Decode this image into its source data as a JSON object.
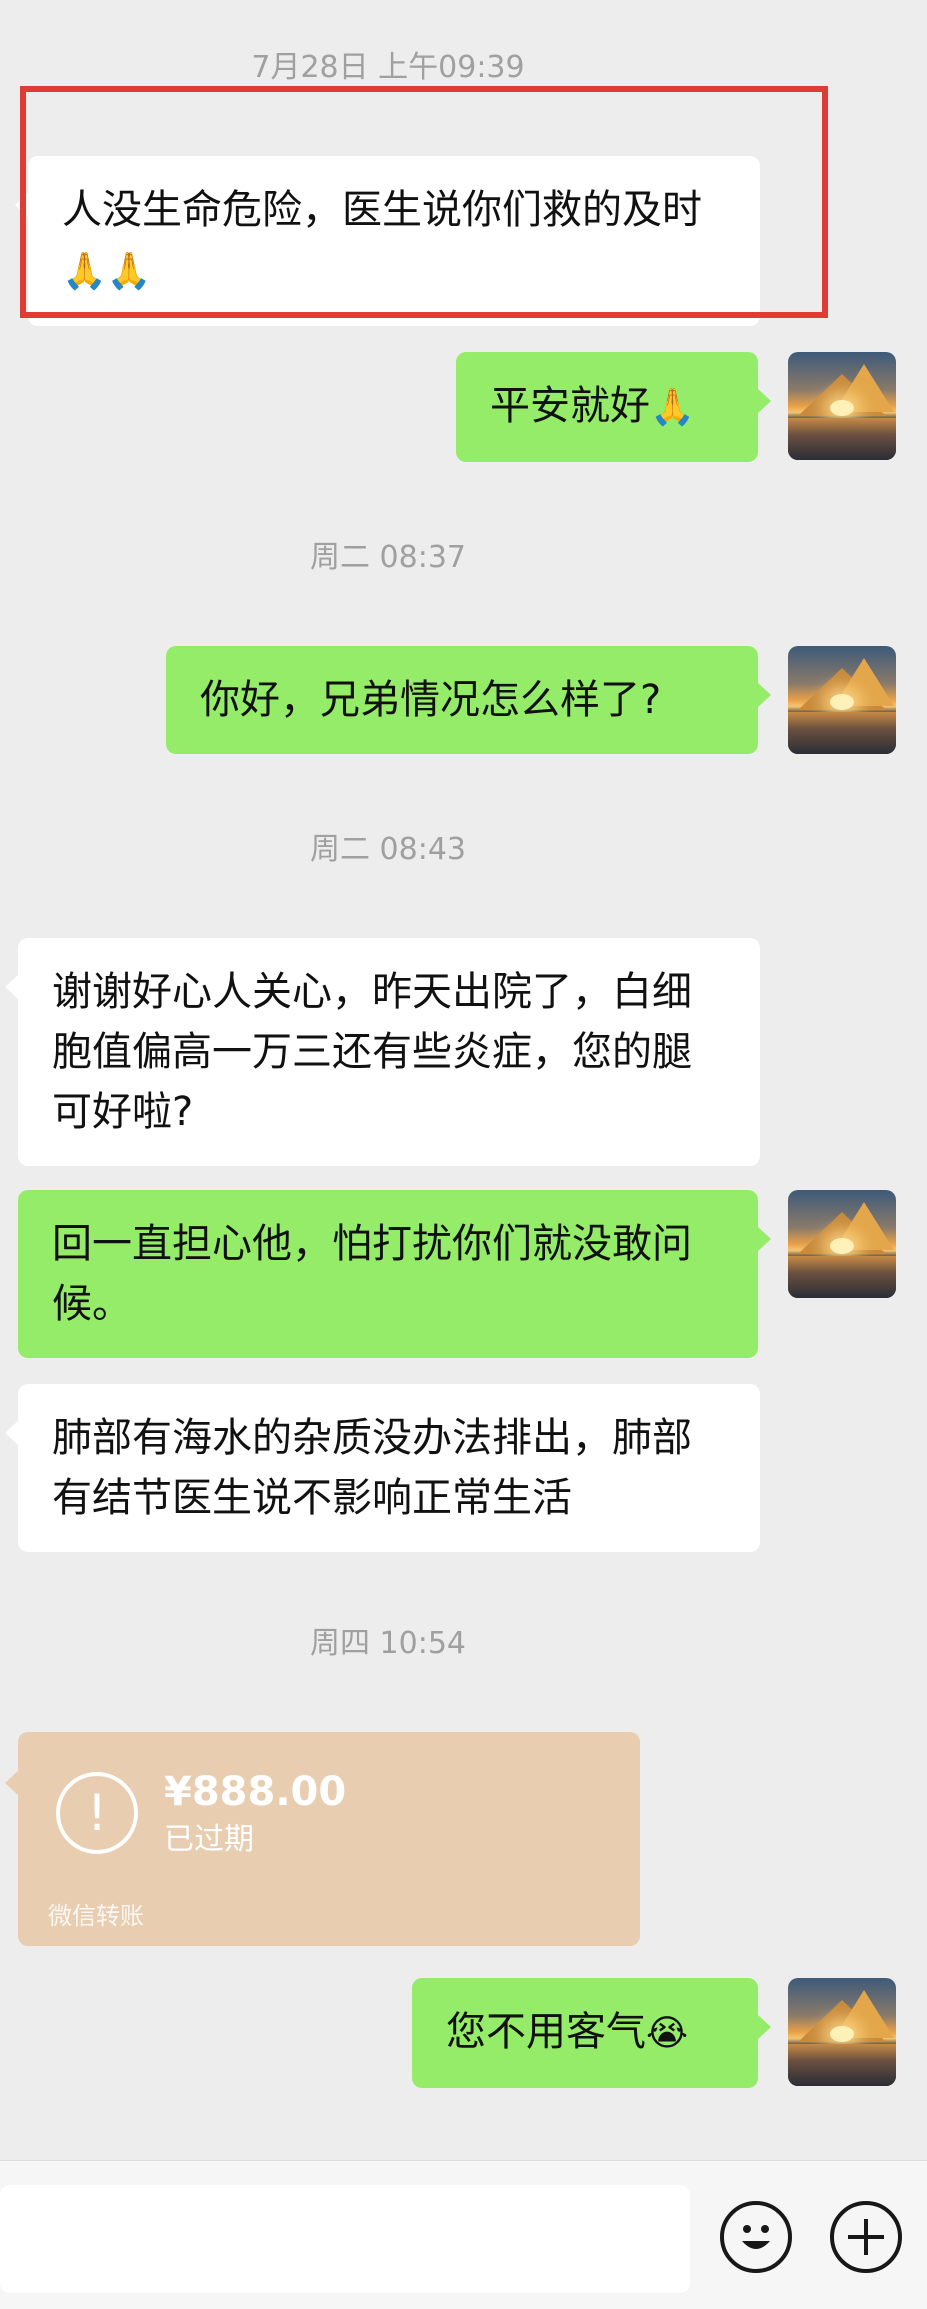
{
  "messages": [
    {
      "kind": "time",
      "text": "7月28日 上午09:39"
    },
    {
      "kind": "in",
      "text": "人没生命危险，医生说你们救的及时",
      "emoji": "🙏🙏"
    },
    {
      "kind": "out",
      "text": "平安就好",
      "emoji": "🙏"
    },
    {
      "kind": "time",
      "text": "周二 08:37"
    },
    {
      "kind": "out",
      "text": "你好，兄弟情况怎么样了?"
    },
    {
      "kind": "time",
      "text": "周二 08:43"
    },
    {
      "kind": "in",
      "text": "谢谢好心人关心，昨天出院了，白细胞值偏高一万三还有些炎症，您的腿可好啦?"
    },
    {
      "kind": "out",
      "text": "回一直担心他，怕打扰你们就没敢问候。"
    },
    {
      "kind": "in",
      "text": "肺部有海水的杂质没办法排出，肺部有结节医生说不影响正常生活"
    },
    {
      "kind": "time",
      "text": "周四 10:54"
    },
    {
      "kind": "transfer",
      "amount": "¥888.00",
      "status": "已过期",
      "footer": "微信转账"
    },
    {
      "kind": "out",
      "text": "您不用客气",
      "emoji": "😭"
    }
  ],
  "input_bar": {
    "emoji_icon": "smiley-face-icon",
    "more_icon": "plus-circle-icon"
  },
  "colors": {
    "background": "#ededed",
    "incoming_bubble": "#ffffff",
    "outgoing_bubble": "#95ec69",
    "transfer_card": "#e8cdb0",
    "highlight_box": "#e03b34",
    "timestamp_text": "#a0a0a0"
  }
}
